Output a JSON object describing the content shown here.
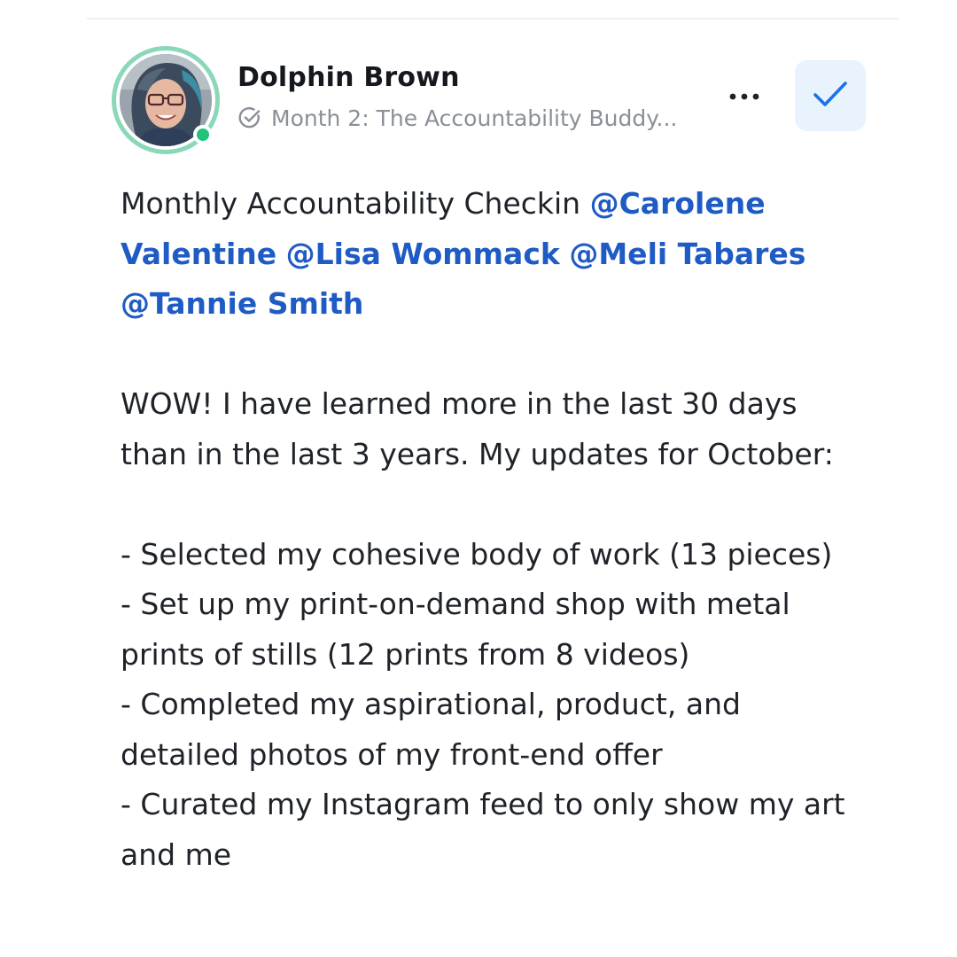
{
  "post": {
    "author": "Dolphin Brown",
    "space": "Month 2: The Accountability Buddy...",
    "icons": {
      "space": "circle-check-icon",
      "more": "ellipsis-icon",
      "check": "check-icon"
    },
    "colors": {
      "mention": "#1f5bc4",
      "online": "#22c27a",
      "avatar_ring": "#8ad8b8",
      "check_bg": "#e8f3fd",
      "check_icon": "#1a73e8"
    },
    "body": {
      "line1_text": "Monthly Accountability Checkin ",
      "mention1": "@Carolene",
      "mention1b": "Valentine",
      "mention2": "@Lisa Wommack",
      "mention3": "@Meli Tabares",
      "mention4": "@Tannie Smith",
      "p2_line1": "WOW!  I have learned more in the last 30 days",
      "p2_line2": "than in the last 3 years.  My updates for October:",
      "b1": "- Selected my cohesive body of work (13 pieces)",
      "b2_l1": "- Set up my print-on-demand shop with metal",
      "b2_l2": "prints of stills (12 prints from 8 videos)",
      "b3_l1": "- Completed my aspirational, product, and",
      "b3_l2": "detailed photos of my front-end offer",
      "b4_l1": "- Curated my Instagram feed to only show my art",
      "b4_l2": "and me"
    }
  }
}
